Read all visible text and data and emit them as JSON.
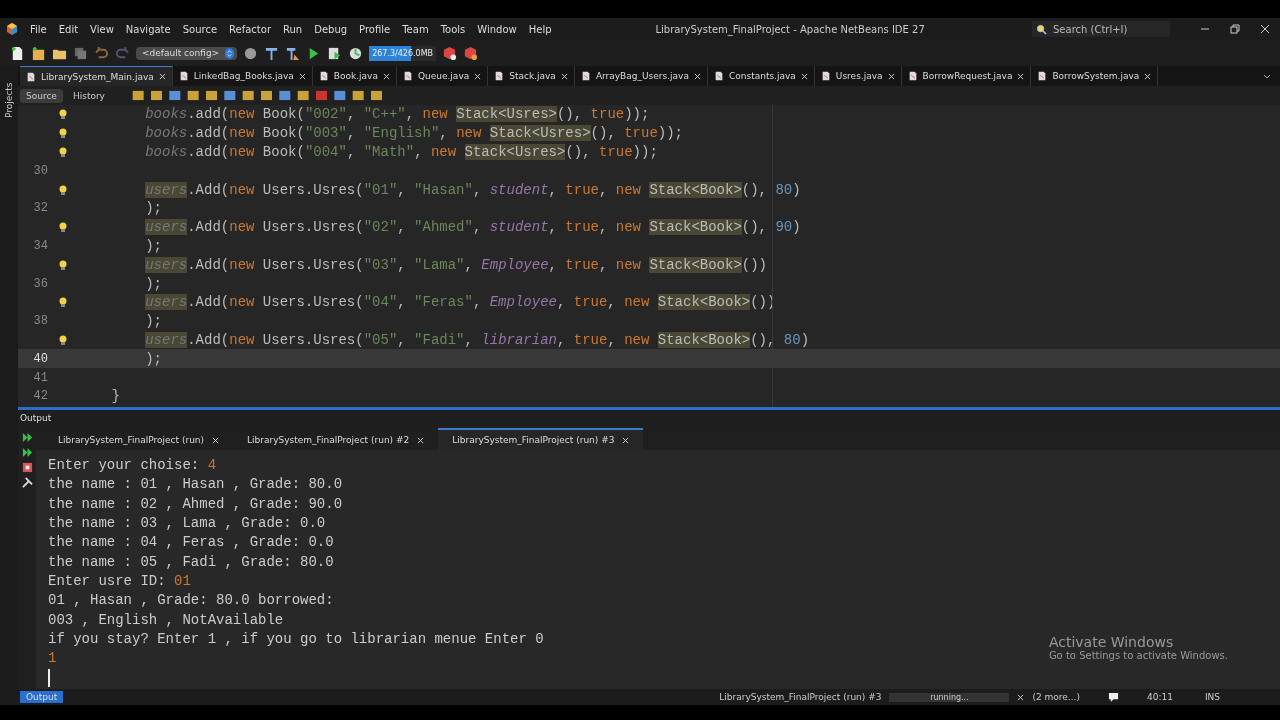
{
  "window": {
    "title": "LibrarySystem_FinalProject - Apache NetBeans IDE 27",
    "search_placeholder": "Search (Ctrl+I)"
  },
  "menu": [
    "File",
    "Edit",
    "View",
    "Navigate",
    "Source",
    "Refactor",
    "Run",
    "Debug",
    "Profile",
    "Team",
    "Tools",
    "Window",
    "Help"
  ],
  "toolbar": {
    "config": "<default config>",
    "memory": {
      "text": "267.3/426.0MB",
      "level": 0.63
    }
  },
  "side_tab": "Projects",
  "editor_tabs": [
    {
      "label": "LibrarySystem_Main.java",
      "selected": true
    },
    {
      "label": "LinkedBag_Books.java",
      "selected": false
    },
    {
      "label": "Book.java",
      "selected": false
    },
    {
      "label": "Queue.java",
      "selected": false
    },
    {
      "label": "Stack.java",
      "selected": false
    },
    {
      "label": "ArrayBag_Users.java",
      "selected": false
    },
    {
      "label": "Constants.java",
      "selected": false
    },
    {
      "label": "Usres.java",
      "selected": false
    },
    {
      "label": "BorrowRequest.java",
      "selected": false
    },
    {
      "label": "BorrowSystem.java",
      "selected": false
    }
  ],
  "editor_views": [
    {
      "label": "Source",
      "selected": true
    },
    {
      "label": "History",
      "selected": false
    }
  ],
  "code_lines": [
    {
      "kind": "statement",
      "hint": true,
      "current": false,
      "tokens": [
        {
          "kind": "field",
          "text": "books"
        },
        {
          "kind": "plain",
          "text": ".add("
        },
        {
          "kind": "kw",
          "text": "new"
        },
        {
          "kind": "plain",
          "text": " Book("
        },
        {
          "kind": "str",
          "text": "\"002\""
        },
        {
          "kind": "plain",
          "text": ", "
        },
        {
          "kind": "str",
          "text": "\"C++\""
        },
        {
          "kind": "plain",
          "text": ", "
        },
        {
          "kind": "kw",
          "text": "new "
        },
        {
          "kind": "marked",
          "text": "Stack<Usres>"
        },
        {
          "kind": "plain",
          "text": "(), "
        },
        {
          "kind": "kw",
          "text": "true"
        },
        {
          "kind": "plain",
          "text": "));"
        }
      ]
    },
    {
      "kind": "statement",
      "hint": true,
      "current": false,
      "tokens": [
        {
          "kind": "field",
          "text": "books"
        },
        {
          "kind": "plain",
          "text": ".add("
        },
        {
          "kind": "kw",
          "text": "new"
        },
        {
          "kind": "plain",
          "text": " Book("
        },
        {
          "kind": "str",
          "text": "\"003\""
        },
        {
          "kind": "plain",
          "text": ", "
        },
        {
          "kind": "str",
          "text": "\"English\""
        },
        {
          "kind": "plain",
          "text": ", "
        },
        {
          "kind": "kw",
          "text": "new "
        },
        {
          "kind": "marked",
          "text": "Stack<Usres>"
        },
        {
          "kind": "plain",
          "text": "(), "
        },
        {
          "kind": "kw",
          "text": "true"
        },
        {
          "kind": "plain",
          "text": "));"
        }
      ]
    },
    {
      "kind": "statement",
      "hint": true,
      "current": false,
      "tokens": [
        {
          "kind": "field",
          "text": "books"
        },
        {
          "kind": "plain",
          "text": ".add("
        },
        {
          "kind": "kw",
          "text": "new"
        },
        {
          "kind": "plain",
          "text": " Book("
        },
        {
          "kind": "str",
          "text": "\"004\""
        },
        {
          "kind": "plain",
          "text": ", "
        },
        {
          "kind": "str",
          "text": "\"Math\""
        },
        {
          "kind": "plain",
          "text": ", "
        },
        {
          "kind": "kw",
          "text": "new "
        },
        {
          "kind": "marked",
          "text": "Stack<Usres>"
        },
        {
          "kind": "plain",
          "text": "(), "
        },
        {
          "kind": "kw",
          "text": "true"
        },
        {
          "kind": "plain",
          "text": "));"
        }
      ]
    },
    {
      "number": "30",
      "hint": false,
      "current": false
    },
    {
      "kind": "statement",
      "hint": true,
      "current": false,
      "tokens": [
        {
          "kind": "field-marked",
          "text": "users"
        },
        {
          "kind": "plain",
          "text": ".Add("
        },
        {
          "kind": "kw",
          "text": "new"
        },
        {
          "kind": "plain",
          "text": " Users.Usres("
        },
        {
          "kind": "str",
          "text": "\"01\""
        },
        {
          "kind": "plain",
          "text": ", "
        },
        {
          "kind": "str",
          "text": "\"Hasan\""
        },
        {
          "kind": "plain",
          "text": ", "
        },
        {
          "kind": "enum",
          "text": "student"
        },
        {
          "kind": "plain",
          "text": ", "
        },
        {
          "kind": "kw",
          "text": "true"
        },
        {
          "kind": "plain",
          "text": ", "
        },
        {
          "kind": "kw",
          "text": "new "
        },
        {
          "kind": "marked",
          "text": "Stack<Book>"
        },
        {
          "kind": "plain",
          "text": "(), "
        },
        {
          "kind": "num",
          "text": "80"
        },
        {
          "kind": "plain",
          "text": ")"
        }
      ]
    },
    {
      "kind": "statement",
      "number": "32",
      "hint": false,
      "current": false,
      "tokens": [
        {
          "kind": "plain",
          "text": ");"
        }
      ]
    },
    {
      "kind": "statement",
      "hint": true,
      "current": false,
      "tokens": [
        {
          "kind": "field-marked",
          "text": "users"
        },
        {
          "kind": "plain",
          "text": ".Add("
        },
        {
          "kind": "kw",
          "text": "new"
        },
        {
          "kind": "plain",
          "text": " Users.Usres("
        },
        {
          "kind": "str",
          "text": "\"02\""
        },
        {
          "kind": "plain",
          "text": ", "
        },
        {
          "kind": "str",
          "text": "\"Ahmed\""
        },
        {
          "kind": "plain",
          "text": ", "
        },
        {
          "kind": "enum",
          "text": "student"
        },
        {
          "kind": "plain",
          "text": ", "
        },
        {
          "kind": "kw",
          "text": "true"
        },
        {
          "kind": "plain",
          "text": ", "
        },
        {
          "kind": "kw",
          "text": "new "
        },
        {
          "kind": "marked",
          "text": "Stack<Book>"
        },
        {
          "kind": "plain",
          "text": "(), "
        },
        {
          "kind": "num",
          "text": "90"
        },
        {
          "kind": "plain",
          "text": ")"
        }
      ]
    },
    {
      "kind": "statement",
      "number": "34",
      "hint": false,
      "current": false,
      "tokens": [
        {
          "kind": "plain",
          "text": ");"
        }
      ]
    },
    {
      "kind": "statement",
      "hint": true,
      "current": false,
      "tokens": [
        {
          "kind": "field-marked",
          "text": "users"
        },
        {
          "kind": "plain",
          "text": ".Add("
        },
        {
          "kind": "kw",
          "text": "new"
        },
        {
          "kind": "plain",
          "text": " Users.Usres("
        },
        {
          "kind": "str",
          "text": "\"03\""
        },
        {
          "kind": "plain",
          "text": ", "
        },
        {
          "kind": "str",
          "text": "\"Lama\""
        },
        {
          "kind": "plain",
          "text": ", "
        },
        {
          "kind": "enum",
          "text": "Employee"
        },
        {
          "kind": "plain",
          "text": ", "
        },
        {
          "kind": "kw",
          "text": "true"
        },
        {
          "kind": "plain",
          "text": ", "
        },
        {
          "kind": "kw",
          "text": "new "
        },
        {
          "kind": "marked",
          "text": "Stack<Book>"
        },
        {
          "kind": "plain",
          "text": "())"
        }
      ]
    },
    {
      "kind": "statement",
      "number": "36",
      "hint": false,
      "current": false,
      "tokens": [
        {
          "kind": "plain",
          "text": ");"
        }
      ]
    },
    {
      "kind": "statement",
      "hint": true,
      "current": false,
      "tokens": [
        {
          "kind": "field-marked",
          "text": "users"
        },
        {
          "kind": "plain",
          "text": ".Add("
        },
        {
          "kind": "kw",
          "text": "new"
        },
        {
          "kind": "plain",
          "text": " Users.Usres("
        },
        {
          "kind": "str",
          "text": "\"04\""
        },
        {
          "kind": "plain",
          "text": ", "
        },
        {
          "kind": "str",
          "text": "\"Feras\""
        },
        {
          "kind": "plain",
          "text": ", "
        },
        {
          "kind": "enum",
          "text": "Employee"
        },
        {
          "kind": "plain",
          "text": ", "
        },
        {
          "kind": "kw",
          "text": "true"
        },
        {
          "kind": "plain",
          "text": ", "
        },
        {
          "kind": "kw",
          "text": "new "
        },
        {
          "kind": "marked",
          "text": "Stack<Book>"
        },
        {
          "kind": "plain",
          "text": "())"
        }
      ]
    },
    {
      "kind": "statement",
      "number": "38",
      "hint": false,
      "current": false,
      "tokens": [
        {
          "kind": "plain",
          "text": ");"
        }
      ]
    },
    {
      "kind": "statement",
      "hint": true,
      "current": false,
      "tokens": [
        {
          "kind": "field-marked",
          "text": "users"
        },
        {
          "kind": "plain",
          "text": ".Add("
        },
        {
          "kind": "kw",
          "text": "new"
        },
        {
          "kind": "plain",
          "text": " Users.Usres("
        },
        {
          "kind": "str",
          "text": "\"05\""
        },
        {
          "kind": "plain",
          "text": ", "
        },
        {
          "kind": "str",
          "text": "\"Fadi\""
        },
        {
          "kind": "plain",
          "text": ", "
        },
        {
          "kind": "enum",
          "text": "librarian"
        },
        {
          "kind": "plain",
          "text": ", "
        },
        {
          "kind": "kw",
          "text": "true"
        },
        {
          "kind": "plain",
          "text": ", "
        },
        {
          "kind": "kw",
          "text": "new "
        },
        {
          "kind": "marked",
          "text": "Stack<Book>"
        },
        {
          "kind": "plain",
          "text": "(), "
        },
        {
          "kind": "num",
          "text": "80"
        },
        {
          "kind": "plain",
          "text": ")"
        }
      ]
    },
    {
      "kind": "statement",
      "number": "40",
      "hint": false,
      "current": true,
      "tokens": [
        {
          "kind": "plain",
          "text": ");"
        }
      ]
    },
    {
      "number": "41",
      "hint": false,
      "current": false
    },
    {
      "kind": "block-end",
      "number": "42",
      "hint": false,
      "current": false,
      "tokens": [
        {
          "kind": "plain",
          "text": "}"
        }
      ]
    }
  ],
  "output": {
    "title": "Output",
    "tabs": [
      {
        "label": "LibrarySystem_FinalProject (run)",
        "selected": false
      },
      {
        "label": "LibrarySystem_FinalProject (run) #2",
        "selected": false
      },
      {
        "label": "LibrarySystem_FinalProject (run) #3",
        "selected": true
      }
    ],
    "lines": [
      [
        {
          "kind": "plain",
          "text": "Enter your choise: "
        },
        {
          "kind": "input",
          "text": "4"
        }
      ],
      [
        {
          "kind": "plain",
          "text": "the name : 01 , Hasan , Grade: 80.0"
        }
      ],
      [
        {
          "kind": "plain",
          "text": "the name : 02 , Ahmed , Grade: 90.0"
        }
      ],
      [
        {
          "kind": "plain",
          "text": "the name : 03 , Lama , Grade: 0.0"
        }
      ],
      [
        {
          "kind": "plain",
          "text": "the name : 04 , Feras , Grade: 0.0"
        }
      ],
      [
        {
          "kind": "plain",
          "text": "the name : 05 , Fadi , Grade: 80.0"
        }
      ],
      [
        {
          "kind": "plain",
          "text": "Enter usre ID: "
        },
        {
          "kind": "input",
          "text": "01"
        }
      ],
      [
        {
          "kind": "plain",
          "text": "01 , Hasan , Grade: 80.0 borrowed:"
        }
      ],
      [
        {
          "kind": "plain",
          "text": "003 , English , NotAvailable"
        }
      ],
      [
        {
          "kind": "plain",
          "text": "if you stay? Enter 1 , if you go to librarian menue Enter 0"
        }
      ],
      [
        {
          "kind": "input",
          "text": "1"
        }
      ]
    ]
  },
  "os_notice": {
    "title": "Activate Windows",
    "text": "Go to Settings to activate Windows."
  },
  "status_bar": {
    "output_button": "Output",
    "task": "LibrarySystem_FinalProject (run) #3",
    "progress": "running...",
    "more": "(2 more...)",
    "position": "40:11",
    "mode": "INS"
  }
}
